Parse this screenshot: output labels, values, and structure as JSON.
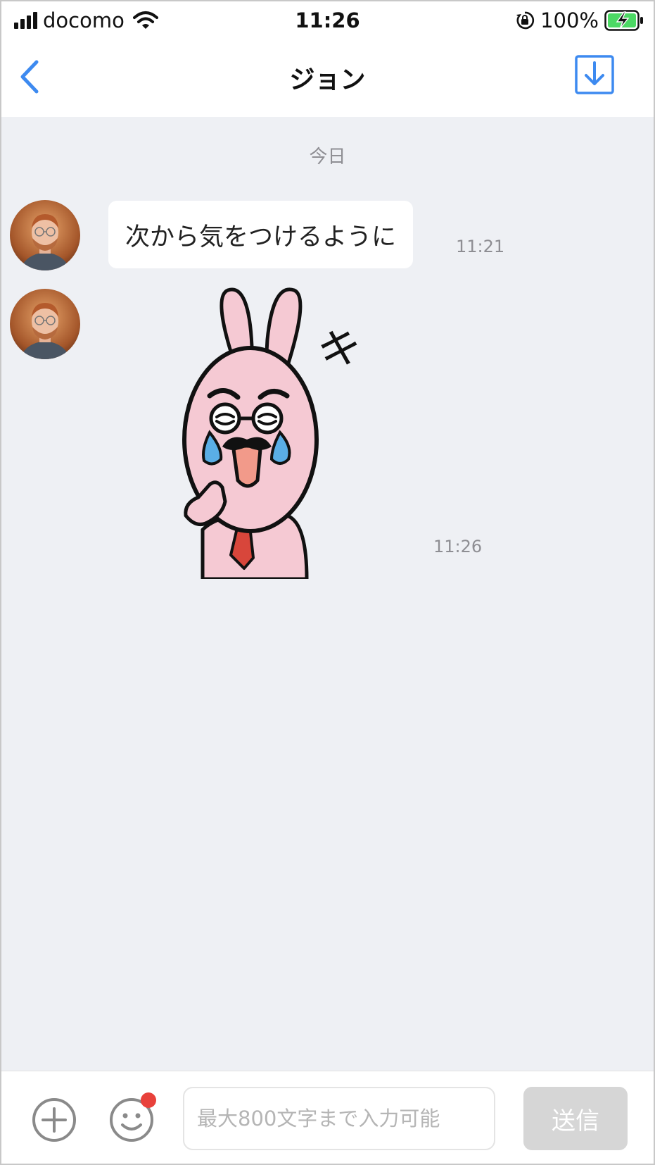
{
  "status_bar": {
    "carrier": "docomo",
    "time": "11:26",
    "battery_percent": "100%",
    "icons": [
      "signal-icon",
      "wifi-icon",
      "orientation-lock-icon",
      "battery-charging-icon"
    ]
  },
  "nav": {
    "title": "ジョン",
    "back_icon": "chevron-left-icon",
    "action_icon": "download-icon",
    "accent_color": "#3d8af0"
  },
  "chat": {
    "date_divider": "今日",
    "messages": [
      {
        "type": "text",
        "text": "次から気をつけるように",
        "time": "11:21"
      },
      {
        "type": "sticker",
        "sticker": "crying-pink-rabbit-with-mustache",
        "sticker_text": "キ",
        "time": "11:26"
      }
    ]
  },
  "input": {
    "placeholder": "最大800文字まで入力可能",
    "send_label": "送信",
    "plus_icon": "plus-circle-icon",
    "emoji_icon": "smiley-icon",
    "notification_dot_color": "#e8413b"
  }
}
